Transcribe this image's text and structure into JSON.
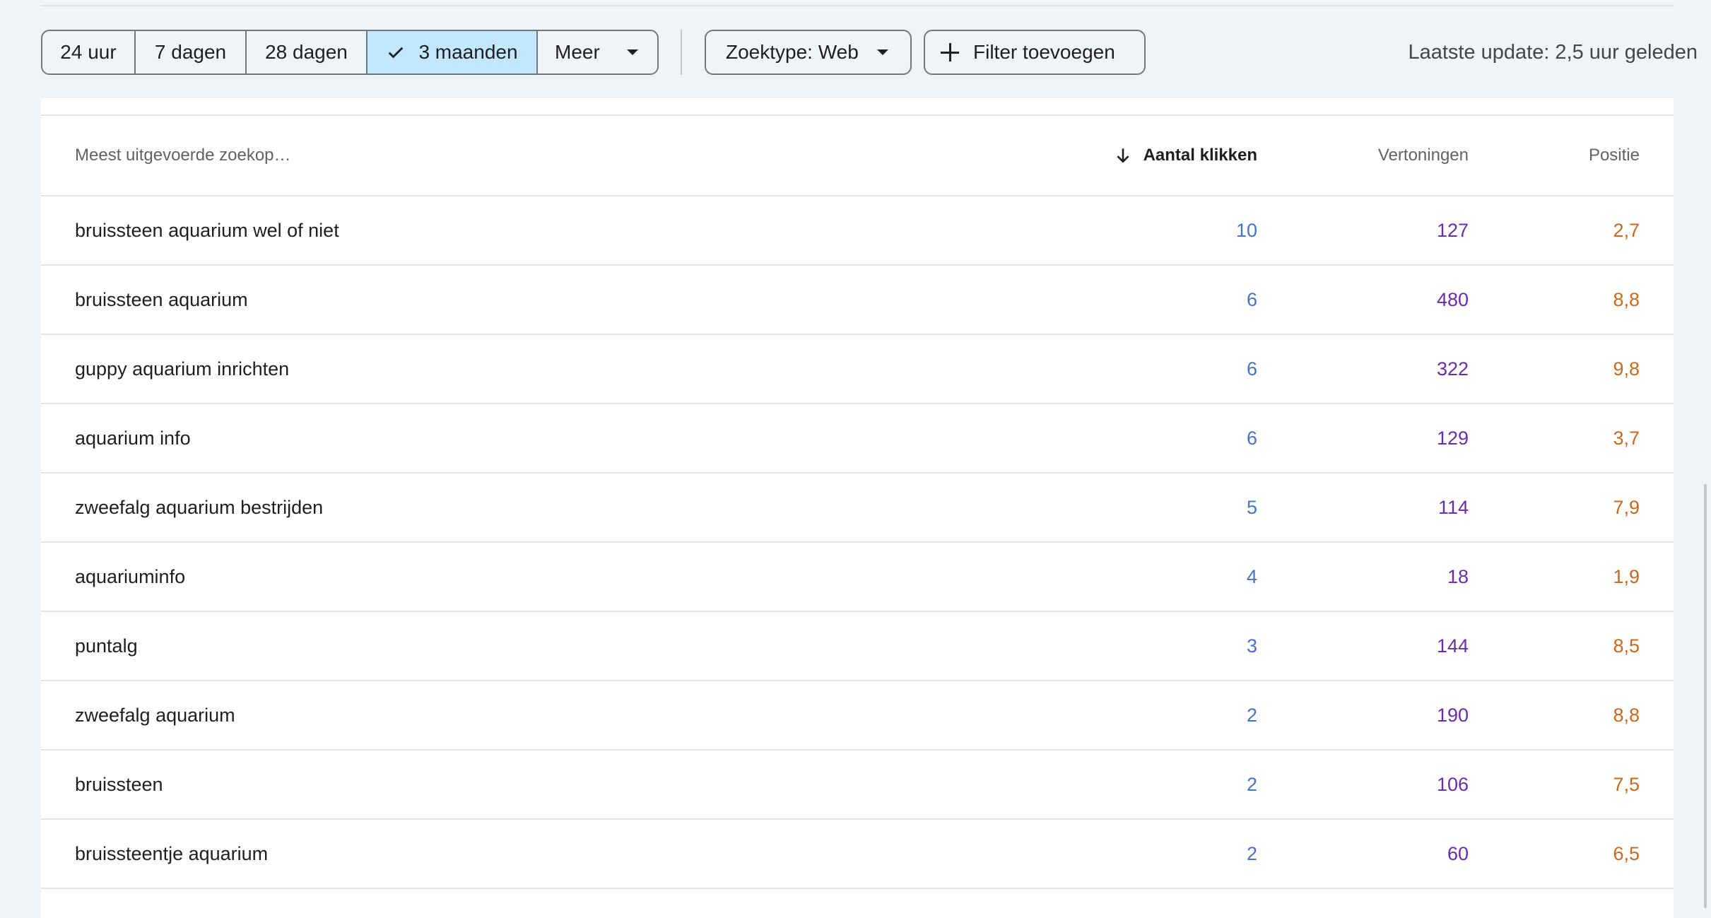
{
  "filters": {
    "ranges": [
      {
        "label": "24 uur",
        "selected": false
      },
      {
        "label": "7 dagen",
        "selected": false
      },
      {
        "label": "28 dagen",
        "selected": false
      },
      {
        "label": "3 maanden",
        "selected": true
      }
    ],
    "more_label": "Meer",
    "search_type_label": "Zoektype: Web",
    "add_filter_label": "Filter toevoegen",
    "last_update": "Laatste update: 2,5 uur geleden"
  },
  "table": {
    "headers": {
      "query": "Meest uitgevoerde zoekop…",
      "clicks": "Aantal klikken",
      "impressions": "Vertoningen",
      "position": "Positie"
    },
    "rows": [
      {
        "query": "bruissteen aquarium wel of niet",
        "clicks": "10",
        "impressions": "127",
        "position": "2,7"
      },
      {
        "query": "bruissteen aquarium",
        "clicks": "6",
        "impressions": "480",
        "position": "8,8"
      },
      {
        "query": "guppy aquarium inrichten",
        "clicks": "6",
        "impressions": "322",
        "position": "9,8"
      },
      {
        "query": "aquarium info",
        "clicks": "6",
        "impressions": "129",
        "position": "3,7"
      },
      {
        "query": "zweefalg aquarium bestrijden",
        "clicks": "5",
        "impressions": "114",
        "position": "7,9"
      },
      {
        "query": "aquariuminfo",
        "clicks": "4",
        "impressions": "18",
        "position": "1,9"
      },
      {
        "query": "puntalg",
        "clicks": "3",
        "impressions": "144",
        "position": "8,5"
      },
      {
        "query": "zweefalg aquarium",
        "clicks": "2",
        "impressions": "190",
        "position": "8,8"
      },
      {
        "query": "bruissteen",
        "clicks": "2",
        "impressions": "106",
        "position": "7,5"
      },
      {
        "query": "bruissteentje aquarium",
        "clicks": "2",
        "impressions": "60",
        "position": "6,5"
      }
    ]
  },
  "colors": {
    "clicks": "#4374c8",
    "impressions": "#6a2da8",
    "position": "#c8691f",
    "selected_chip": "#c2e7ff"
  }
}
